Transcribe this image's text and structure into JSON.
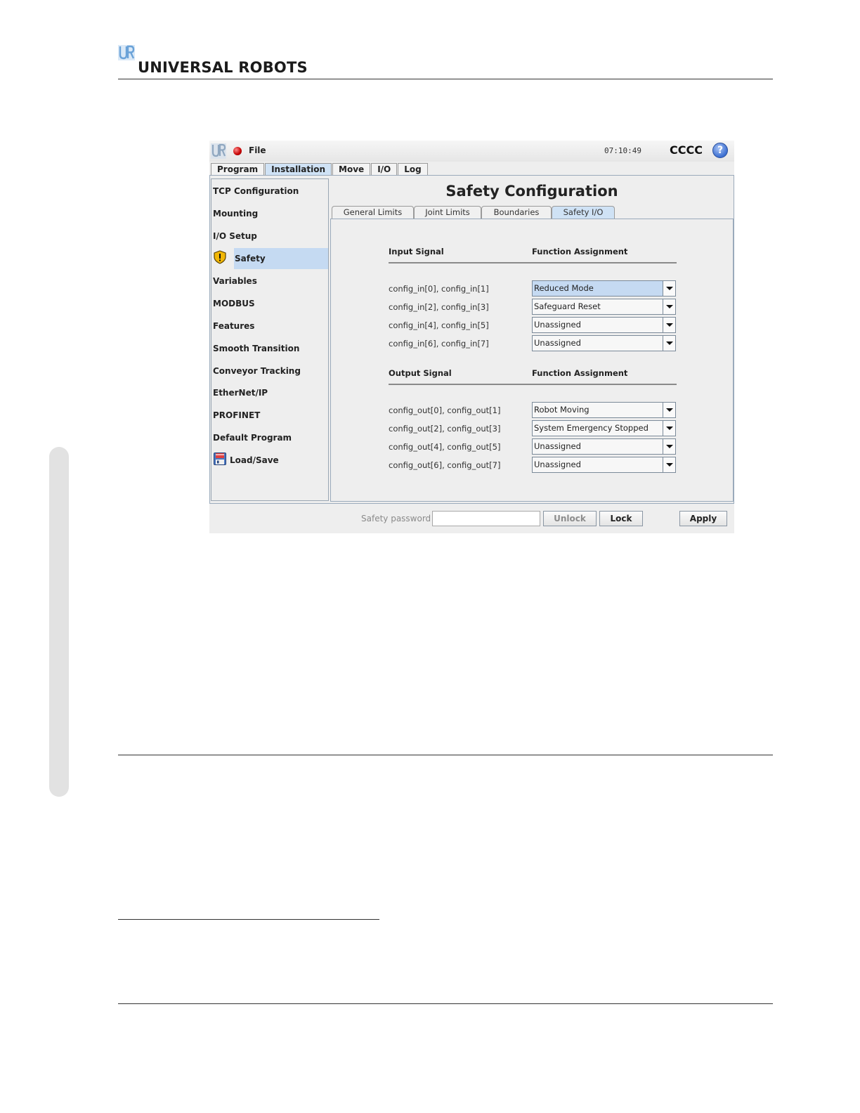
{
  "document": {
    "brand": "UNIVERSAL ROBOTS"
  },
  "app": {
    "menu": "File",
    "clock": "07:10:49",
    "robot_name": "CCCC",
    "help_label": "?"
  },
  "main_tabs": [
    {
      "label": "Program"
    },
    {
      "label": "Installation"
    },
    {
      "label": "Move"
    },
    {
      "label": "I/O"
    },
    {
      "label": "Log"
    }
  ],
  "sidebar": {
    "items": [
      {
        "label": "TCP Configuration"
      },
      {
        "label": "Mounting"
      },
      {
        "label": "I/O Setup"
      },
      {
        "label": "Safety"
      },
      {
        "label": "Variables"
      },
      {
        "label": "MODBUS"
      },
      {
        "label": "Features"
      },
      {
        "label": "Smooth Transition"
      },
      {
        "label": "Conveyor Tracking"
      },
      {
        "label": "EtherNet/IP"
      },
      {
        "label": "PROFINET"
      },
      {
        "label": "Default Program"
      },
      {
        "label": "Load/Save"
      }
    ]
  },
  "content": {
    "title": "Safety Configuration",
    "sub_tabs": [
      {
        "label": "General Limits"
      },
      {
        "label": "Joint Limits"
      },
      {
        "label": "Boundaries"
      },
      {
        "label": "Safety I/O"
      }
    ],
    "input_section": {
      "signal_header": "Input Signal",
      "function_header": "Function Assignment",
      "rows": [
        {
          "signal": "config_in[0], config_in[1]",
          "function": "Reduced Mode"
        },
        {
          "signal": "config_in[2], config_in[3]",
          "function": "Safeguard Reset"
        },
        {
          "signal": "config_in[4], config_in[5]",
          "function": "Unassigned"
        },
        {
          "signal": "config_in[6], config_in[7]",
          "function": "Unassigned"
        }
      ]
    },
    "output_section": {
      "signal_header": "Output Signal",
      "function_header": "Function Assignment",
      "rows": [
        {
          "signal": "config_out[0], config_out[1]",
          "function": "Robot Moving"
        },
        {
          "signal": "config_out[2], config_out[3]",
          "function": "System Emergency Stopped"
        },
        {
          "signal": "config_out[4], config_out[5]",
          "function": "Unassigned"
        },
        {
          "signal": "config_out[6], config_out[7]",
          "function": "Unassigned"
        }
      ]
    }
  },
  "bottom_bar": {
    "password_label": "Safety password",
    "password_value": "",
    "unlock_label": "Unlock",
    "lock_label": "Lock",
    "apply_label": "Apply"
  },
  "colors": {
    "selection": "#c5daf2",
    "active_tab": "#cfe2f5",
    "status_dot": "#c40000",
    "help_icon": "#3c6fd1",
    "warning_icon": "#f2b705"
  }
}
